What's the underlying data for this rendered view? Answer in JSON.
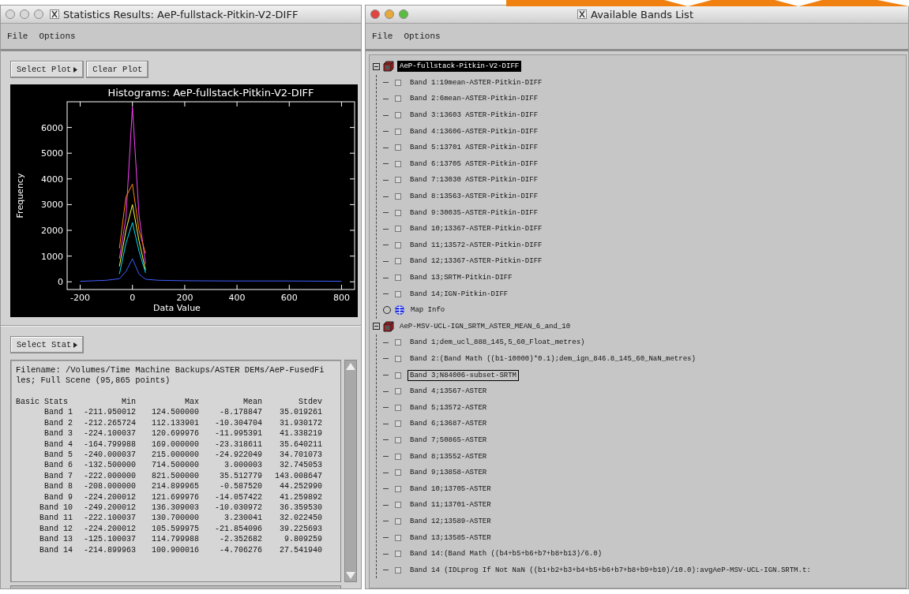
{
  "stats_window": {
    "title": "Statistics Results: AeP-fullstack-Pitkin-V2-DIFF",
    "menu": [
      "File",
      "Options"
    ],
    "plot_buttons": [
      {
        "label": "Select Plot",
        "kind": "menu"
      },
      {
        "label": "Clear Plot",
        "kind": "plain"
      }
    ],
    "histogram": {
      "chart_data": {
        "type": "line",
        "title": "Histograms: AeP-fullstack-Pitkin-V2-DIFF",
        "xlabel": "Data Value",
        "ylabel": "Frequency",
        "x": [
          -200,
          -100,
          -50,
          -25,
          0,
          25,
          50,
          100,
          200,
          400,
          600,
          800
        ],
        "xlim": [
          -250,
          850
        ],
        "ylim": [
          -300,
          7000
        ],
        "xticks": [
          -200,
          0,
          200,
          400,
          600,
          800
        ],
        "yticks": [
          0,
          1000,
          2000,
          3000,
          4000,
          5000,
          6000
        ],
        "series": [
          {
            "color": "#ff40ff",
            "values": [
              null,
              null,
              900,
              2500,
              6800,
              2600,
              700,
              null,
              null,
              null,
              null,
              null
            ]
          },
          {
            "color": "#ff8800",
            "values": [
              null,
              null,
              1300,
              3300,
              3800,
              2000,
              1100,
              null,
              null,
              null,
              null,
              null
            ]
          },
          {
            "color": "#ffff40",
            "values": [
              null,
              null,
              600,
              2000,
              3000,
              1600,
              450,
              null,
              null,
              null,
              null,
              null
            ]
          },
          {
            "color": "#00e0ff",
            "values": [
              null,
              null,
              300,
              1500,
              2300,
              1200,
              350,
              null,
              null,
              null,
              null,
              null
            ]
          },
          {
            "color": "#4060ff",
            "values": [
              20,
              60,
              120,
              400,
              900,
              300,
              100,
              60,
              40,
              30,
              30,
              20
            ]
          }
        ]
      }
    },
    "stat_button": {
      "label": "Select Stat",
      "kind": "menu"
    },
    "report": {
      "filename_lines": [
        "Filename: /Volumes/Time Machine Backups/ASTER DEMs/AeP-FusedFi",
        "les; Full Scene (95,865 points)"
      ],
      "columns": [
        "Basic Stats",
        "Min",
        "Max",
        "Mean",
        "Stdev"
      ],
      "rows": [
        [
          "Band 1",
          "-211.950012",
          "124.500000",
          "-8.178847",
          "35.019261"
        ],
        [
          "Band 2",
          "-212.265724",
          "112.133901",
          "-10.304704",
          "31.930172"
        ],
        [
          "Band 3",
          "-224.100037",
          "120.699976",
          "-11.995391",
          "41.338219"
        ],
        [
          "Band 4",
          "-164.799988",
          "169.000000",
          "-23.318611",
          "35.640211"
        ],
        [
          "Band 5",
          "-240.000037",
          "215.000000",
          "-24.922049",
          "34.701073"
        ],
        [
          "Band 6",
          "-132.500000",
          "714.500000",
          "3.000003",
          "32.745053"
        ],
        [
          "Band 7",
          "-222.000000",
          "821.500000",
          "35.512779",
          "143.008647"
        ],
        [
          "Band 8",
          "-208.000000",
          "214.899965",
          "-0.587520",
          "44.252990"
        ],
        [
          "Band 9",
          "-224.200012",
          "121.699976",
          "-14.057422",
          "41.259892"
        ],
        [
          "Band 10",
          "-249.200012",
          "136.309003",
          "-10.030972",
          "36.359530"
        ],
        [
          "Band 11",
          "-222.100037",
          "130.700000",
          "3.230041",
          "32.022450"
        ],
        [
          "Band 12",
          "-224.200012",
          "105.599975",
          "-21.854096",
          "39.225693"
        ],
        [
          "Band 13",
          "-125.100037",
          "114.799988",
          "-2.352682",
          "9.809259"
        ],
        [
          "Band 14",
          "-214.899963",
          "100.900016",
          "-4.706276",
          "27.541940"
        ]
      ]
    }
  },
  "bands_window": {
    "title": "Available Bands List",
    "menu": [
      "File",
      "Options"
    ],
    "tree": [
      {
        "kind": "file",
        "label": "AeP-fullstack-Pitkin-V2-DIFF",
        "expanded": true,
        "selected": true,
        "focused": false,
        "children": [
          {
            "kind": "band",
            "label": "Band 1:19mean-ASTER-Pitkin-DIFF",
            "selected": false,
            "focused": false
          },
          {
            "kind": "band",
            "label": "Band 2:6mean-ASTER-Pitkin-DIFF",
            "selected": false,
            "focused": false
          },
          {
            "kind": "band",
            "label": "Band 3:13603 ASTER-Pitkin-DIFF",
            "selected": false,
            "focused": false
          },
          {
            "kind": "band",
            "label": "Band 4:13606-ASTER-Pitkin-DIFF",
            "selected": false,
            "focused": false
          },
          {
            "kind": "band",
            "label": "Band 5:13701 ASTER-Pitkin-DIFF",
            "selected": false,
            "focused": false
          },
          {
            "kind": "band",
            "label": "Band 6:13705 ASTER-Pitkin-DIFF",
            "selected": false,
            "focused": false
          },
          {
            "kind": "band",
            "label": "Band 7:13030 ASTER-Pitkin-DIFF",
            "selected": false,
            "focused": false
          },
          {
            "kind": "band",
            "label": "Band 8:13563-ASTER-Pitkin-DIFF",
            "selected": false,
            "focused": false
          },
          {
            "kind": "band",
            "label": "Band 9:30035-ASTER-Pitkin-DIFF",
            "selected": false,
            "focused": false
          },
          {
            "kind": "band",
            "label": "Band 10;13367-ASTER-Pitkin-DIFF",
            "selected": false,
            "focused": false
          },
          {
            "kind": "band",
            "label": "Band 11;13572-ASTER-Pitkin-DIFF",
            "selected": false,
            "focused": false
          },
          {
            "kind": "band",
            "label": "Band 12;13367-ASTER-Pitkin-DIFF",
            "selected": false,
            "focused": false
          },
          {
            "kind": "band",
            "label": "Band 13;SRTM-Pitkin-DIFF",
            "selected": false,
            "focused": false
          },
          {
            "kind": "band",
            "label": "Band 14;IGN-Pitkin-DIFF",
            "selected": false,
            "focused": false
          },
          {
            "kind": "map-info",
            "label": "Map Info",
            "expanded": false,
            "selected": false,
            "focused": false
          }
        ]
      },
      {
        "kind": "file",
        "label": "AeP-MSV-UCL-IGN_SRTM_ASTER_MEAN_6_and_10",
        "expanded": true,
        "selected": false,
        "focused": false,
        "children": [
          {
            "kind": "band",
            "label": "Band 1;dem_ucl_888_145,5_60_Float_metres)",
            "selected": false,
            "focused": false
          },
          {
            "kind": "band",
            "label": "Band 2:(Band Math ((b1-10000)*0.1);dem_ign_846.8_145_60_NaN_metres)",
            "selected": false,
            "focused": false
          },
          {
            "kind": "band",
            "label": "Band 3;N84006-subset-SRTM",
            "selected": false,
            "focused": true
          },
          {
            "kind": "band",
            "label": "Band 4;13567-ASTER",
            "selected": false,
            "focused": false
          },
          {
            "kind": "band",
            "label": "Band 5;13572-ASTER",
            "selected": false,
            "focused": false
          },
          {
            "kind": "band",
            "label": "Band 6;13687-ASTER",
            "selected": false,
            "focused": false
          },
          {
            "kind": "band",
            "label": "Band 7;50865-ASTER",
            "selected": false,
            "focused": false
          },
          {
            "kind": "band",
            "label": "Band 8;13552-ASTER",
            "selected": false,
            "focused": false
          },
          {
            "kind": "band",
            "label": "Band 9;13858-ASTER",
            "selected": false,
            "focused": false
          },
          {
            "kind": "band",
            "label": "Band 10;13705-ASTER",
            "selected": false,
            "focused": false
          },
          {
            "kind": "band",
            "label": "Band 11;13701-ASTER",
            "selected": false,
            "focused": false
          },
          {
            "kind": "band",
            "label": "Band 12;13589-ASTER",
            "selected": false,
            "focused": false
          },
          {
            "kind": "band",
            "label": "Band 13;13585-ASTER",
            "selected": false,
            "focused": false
          },
          {
            "kind": "band",
            "label": "Band 14:(Band Math ((b4+b5+b6+b7+b8+b13)/6.0)",
            "selected": false,
            "focused": false
          },
          {
            "kind": "band",
            "label": "Band 14 (IDLprog If Not NaN ((b1+b2+b3+b4+b5+b6+b7+b8+b9+b10)/10.0):avgAeP-MSV-UCL-IGN.SRTM.t:",
            "selected": false,
            "focused": false
          }
        ]
      }
    ]
  }
}
